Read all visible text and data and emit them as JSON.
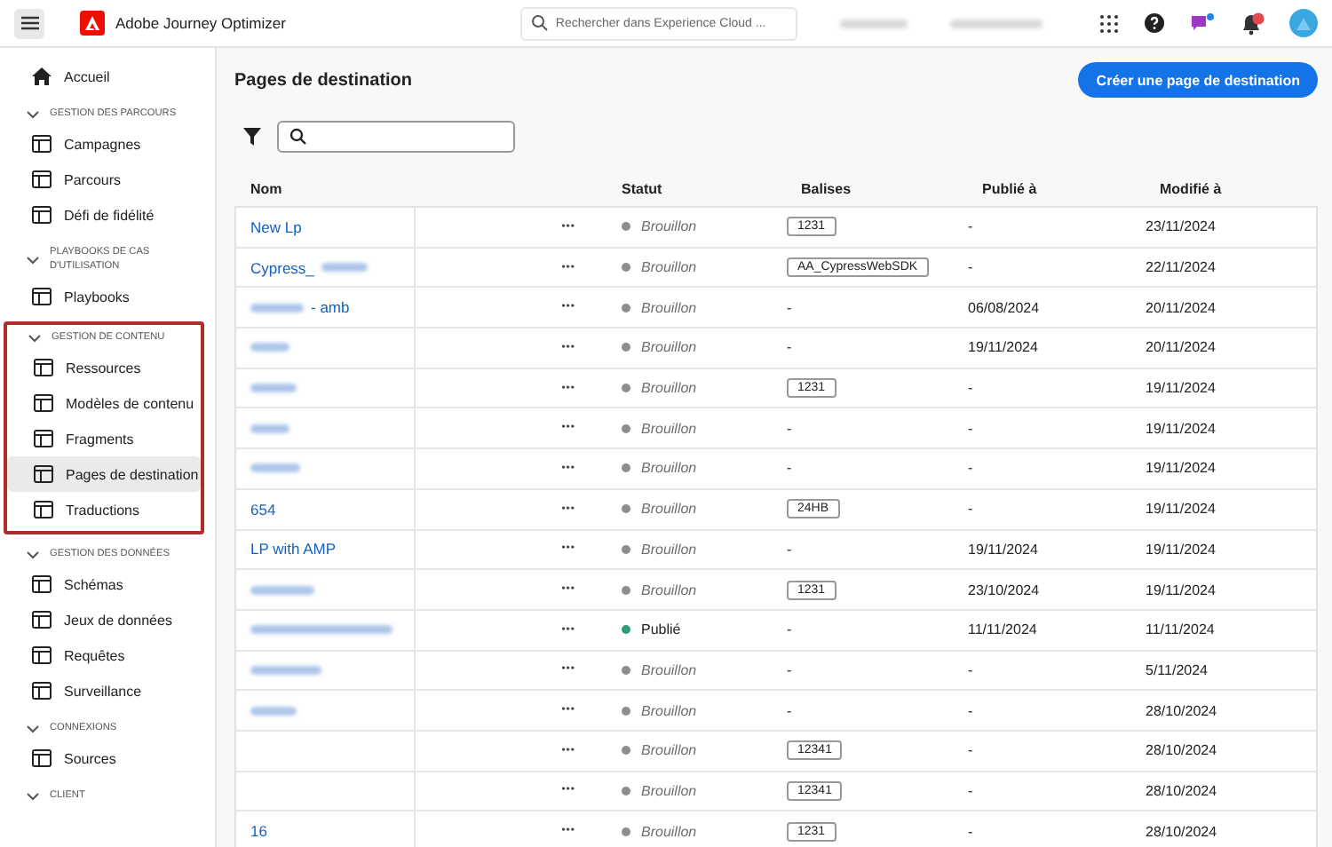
{
  "header": {
    "app_title": "Adobe Journey Optimizer",
    "search": {
      "placeholder": "Rechercher dans Experience Cloud ..."
    },
    "blurred_items": [
      {
        "kind": "blur"
      },
      {
        "kind": "blur"
      }
    ],
    "notifications_badge": true,
    "chat_dot": true
  },
  "sidebar": {
    "home": {
      "label": "Accueil",
      "selected": false
    },
    "sections": [
      {
        "title": "GESTION DES PARCOURS",
        "expanded": true,
        "highlighted": false,
        "items": [
          {
            "label": "Campagnes",
            "selected": false
          },
          {
            "label": "Parcours",
            "selected": false
          },
          {
            "label": "Défi de fidélité",
            "selected": false
          }
        ]
      },
      {
        "title": "PLAYBOOKS DE CAS D'UTILISATION",
        "expanded": true,
        "highlighted": false,
        "items": [
          {
            "label": "Playbooks",
            "selected": false
          }
        ]
      },
      {
        "title": "GESTION DE CONTENU",
        "expanded": true,
        "highlighted": true,
        "items": [
          {
            "label": "Ressources",
            "selected": false
          },
          {
            "label": "Modèles de contenu",
            "selected": false
          },
          {
            "label": "Fragments",
            "selected": false
          },
          {
            "label": "Pages de destination",
            "selected": true
          },
          {
            "label": "Traductions",
            "selected": false
          }
        ]
      },
      {
        "title": "GESTION DES DONNÉES",
        "expanded": true,
        "highlighted": false,
        "items": [
          {
            "label": "Schémas",
            "selected": false
          },
          {
            "label": "Jeux de données",
            "selected": false
          },
          {
            "label": "Requêtes",
            "selected": false
          },
          {
            "label": "Surveillance",
            "selected": false
          }
        ]
      },
      {
        "title": "CONNEXIONS",
        "expanded": true,
        "highlighted": false,
        "items": [
          {
            "label": "Sources",
            "selected": false
          }
        ]
      },
      {
        "title": "CLIENT",
        "expanded": true,
        "highlighted": false
      }
    ]
  },
  "page": {
    "title": "Pages de destination",
    "create_button": "Créer une page de destination"
  },
  "table": {
    "columns": [
      "Nom",
      "Statut",
      "Balises",
      "Publié à",
      "Modifié à"
    ],
    "rows": [
      {
        "name": "New Lp",
        "blur_before": false,
        "blur_after": false,
        "actions": "•••",
        "status": "Brouillon",
        "draft": true,
        "color": "#8e8e8e",
        "tag": "1231",
        "published": "-",
        "modified": "23/11/2024"
      },
      {
        "name": "Cypress_",
        "blur_before": false,
        "blur_after": true,
        "actions": "•••",
        "status": "Brouillon",
        "draft": true,
        "color": "#8e8e8e",
        "tag": "AA_CypressWebSDK",
        "published": "-",
        "modified": "22/11/2024"
      },
      {
        "name": "- amb",
        "blur_before": true,
        "blur_after": false,
        "actions": "•••",
        "status": "Brouillon",
        "draft": true,
        "color": "#8e8e8e",
        "tag_text": "-",
        "published": "06/08/2024",
        "modified": "20/11/2024"
      },
      {
        "blur_before": true,
        "blur_after": false,
        "actions": "•••",
        "status": "Brouillon",
        "draft": true,
        "color": "#8e8e8e",
        "tag_text": "-",
        "published": "19/11/2024",
        "modified": "20/11/2024"
      },
      {
        "blur_before": true,
        "blur_after": false,
        "actions": "•••",
        "status": "Brouillon",
        "draft": true,
        "color": "#8e8e8e",
        "tag": "1231",
        "published": "-",
        "modified": "19/11/2024"
      },
      {
        "blur_before": true,
        "blur_after": false,
        "actions": "•••",
        "status": "Brouillon",
        "draft": true,
        "color": "#8e8e8e",
        "tag_text": "-",
        "published": "-",
        "modified": "19/11/2024"
      },
      {
        "blur_before": true,
        "blur_after": false,
        "actions": "•••",
        "status": "Brouillon",
        "draft": true,
        "color": "#8e8e8e",
        "tag_text": "-",
        "published": "-",
        "modified": "19/11/2024"
      },
      {
        "name": "654",
        "blur_before": false,
        "blur_after": false,
        "actions": "•••",
        "status": "Brouillon",
        "draft": true,
        "color": "#8e8e8e",
        "tag": "24HB",
        "published": "-",
        "modified": "19/11/2024"
      },
      {
        "name": "LP with AMP",
        "blur_before": false,
        "blur_after": false,
        "actions": "•••",
        "status": "Brouillon",
        "draft": true,
        "color": "#8e8e8e",
        "tag_text": "-",
        "published": "19/11/2024",
        "modified": "19/11/2024"
      },
      {
        "blur_before": true,
        "blur_after": false,
        "actions": "•••",
        "status": "Brouillon",
        "draft": true,
        "color": "#8e8e8e",
        "tag": "1231",
        "published": "23/10/2024",
        "modified": "19/11/2024"
      },
      {
        "blur_before": true,
        "blur_after": false,
        "actions": "•••",
        "status": "Publié",
        "draft": false,
        "color": "#2d9d78",
        "tag_text": "-",
        "published": "11/11/2024",
        "modified": "11/11/2024"
      },
      {
        "blur_before": true,
        "blur_after": false,
        "actions": "•••",
        "status": "Brouillon",
        "draft": true,
        "color": "#8e8e8e",
        "tag_text": "-",
        "published": "-",
        "modified": "5/11/2024"
      },
      {
        "blur_before": true,
        "blur_after": false,
        "actions": "•••",
        "status": "Brouillon",
        "draft": true,
        "color": "#8e8e8e",
        "tag_text": "-",
        "published": "-",
        "modified": "28/10/2024"
      },
      {
        "blur_before": false,
        "blur_after": false,
        "actions": "•••",
        "status": "Brouillon",
        "draft": true,
        "color": "#8e8e8e",
        "tag": "12341",
        "published": "-",
        "modified": "28/10/2024"
      },
      {
        "blur_before": false,
        "blur_after": false,
        "actions": "•••",
        "status": "Brouillon",
        "draft": true,
        "color": "#8e8e8e",
        "tag": "12341",
        "published": "-",
        "modified": "28/10/2024"
      },
      {
        "name": "16",
        "blur_before": false,
        "blur_after": false,
        "actions": "•••",
        "status": "Brouillon",
        "draft": true,
        "color": "#8e8e8e",
        "tag": "1231",
        "published": "-",
        "modified": "28/10/2024"
      }
    ]
  }
}
